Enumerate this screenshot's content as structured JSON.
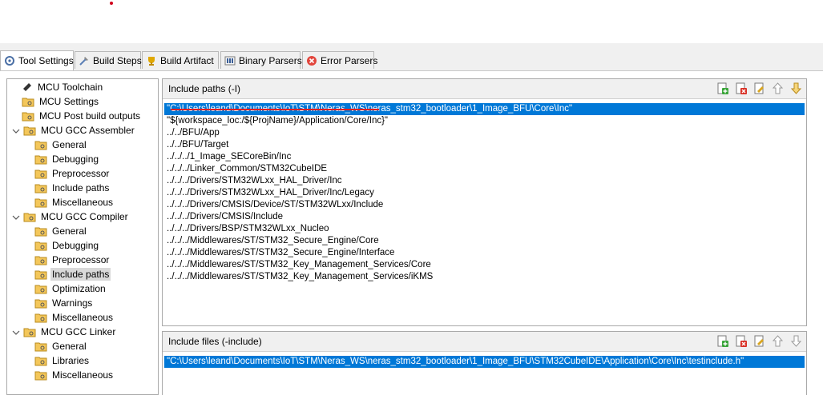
{
  "tabs": [
    {
      "label": "Tool Settings",
      "icon": "tool-settings-icon",
      "active": true
    },
    {
      "label": "Build Steps",
      "icon": "build-steps-icon",
      "active": false
    },
    {
      "label": "Build Artifact",
      "icon": "build-artifact-icon",
      "active": false
    },
    {
      "label": "Binary Parsers",
      "icon": "binary-parsers-icon",
      "active": false
    },
    {
      "label": "Error Parsers",
      "icon": "error-parsers-icon",
      "active": false
    }
  ],
  "tree": [
    {
      "label": "MCU Toolchain"
    },
    {
      "label": "MCU Settings"
    },
    {
      "label": "MCU Post build outputs"
    },
    {
      "label": "MCU GCC Assembler",
      "expanded": true
    },
    {
      "label": "General"
    },
    {
      "label": "Debugging"
    },
    {
      "label": "Preprocessor"
    },
    {
      "label": "Include paths"
    },
    {
      "label": "Miscellaneous"
    },
    {
      "label": "MCU GCC Compiler",
      "expanded": true
    },
    {
      "label": "General"
    },
    {
      "label": "Debugging"
    },
    {
      "label": "Preprocessor"
    },
    {
      "label": "Include paths",
      "selected": true
    },
    {
      "label": "Optimization"
    },
    {
      "label": "Warnings"
    },
    {
      "label": "Miscellaneous"
    },
    {
      "label": "MCU GCC Linker",
      "expanded": true
    },
    {
      "label": "General"
    },
    {
      "label": "Libraries"
    },
    {
      "label": "Miscellaneous"
    }
  ],
  "include_paths": {
    "title": "Include paths (-I)",
    "items": [
      "\"C:\\Users\\leand\\Documents\\IoT\\STM\\Neras_WS\\neras_stm32_bootloader\\1_Image_BFU\\Core\\Inc\"",
      "\"${workspace_loc:/${ProjName}/Application/Core/Inc}\"",
      "../../BFU/App",
      "../../BFU/Target",
      "../../../1_Image_SECoreBin/Inc",
      "../../../Linker_Common/STM32CubeIDE",
      "../../../Drivers/STM32WLxx_HAL_Driver/Inc",
      "../../../Drivers/STM32WLxx_HAL_Driver/Inc/Legacy",
      "../../../Drivers/CMSIS/Device/ST/STM32WLxx/Include",
      "../../../Drivers/CMSIS/Include",
      "../../../Drivers/BSP/STM32WLxx_Nucleo",
      "../../../Middlewares/ST/STM32_Secure_Engine/Core",
      "../../../Middlewares/ST/STM32_Secure_Engine/Interface",
      "../../../Middlewares/ST/STM32_Key_Management_Services/Core",
      "../../../Middlewares/ST/STM32_Key_Management_Services/iKMS"
    ]
  },
  "include_files": {
    "title": "Include files (-include)",
    "items": [
      "\"C:\\Users\\leand\\Documents\\IoT\\STM\\Neras_WS\\neras_stm32_bootloader\\1_Image_BFU\\STM32CubeIDE\\Application\\Core\\Inc\\testinclude.h\""
    ]
  },
  "colors": {
    "selection": "#0078d7",
    "annotation_red": "#e02020"
  }
}
